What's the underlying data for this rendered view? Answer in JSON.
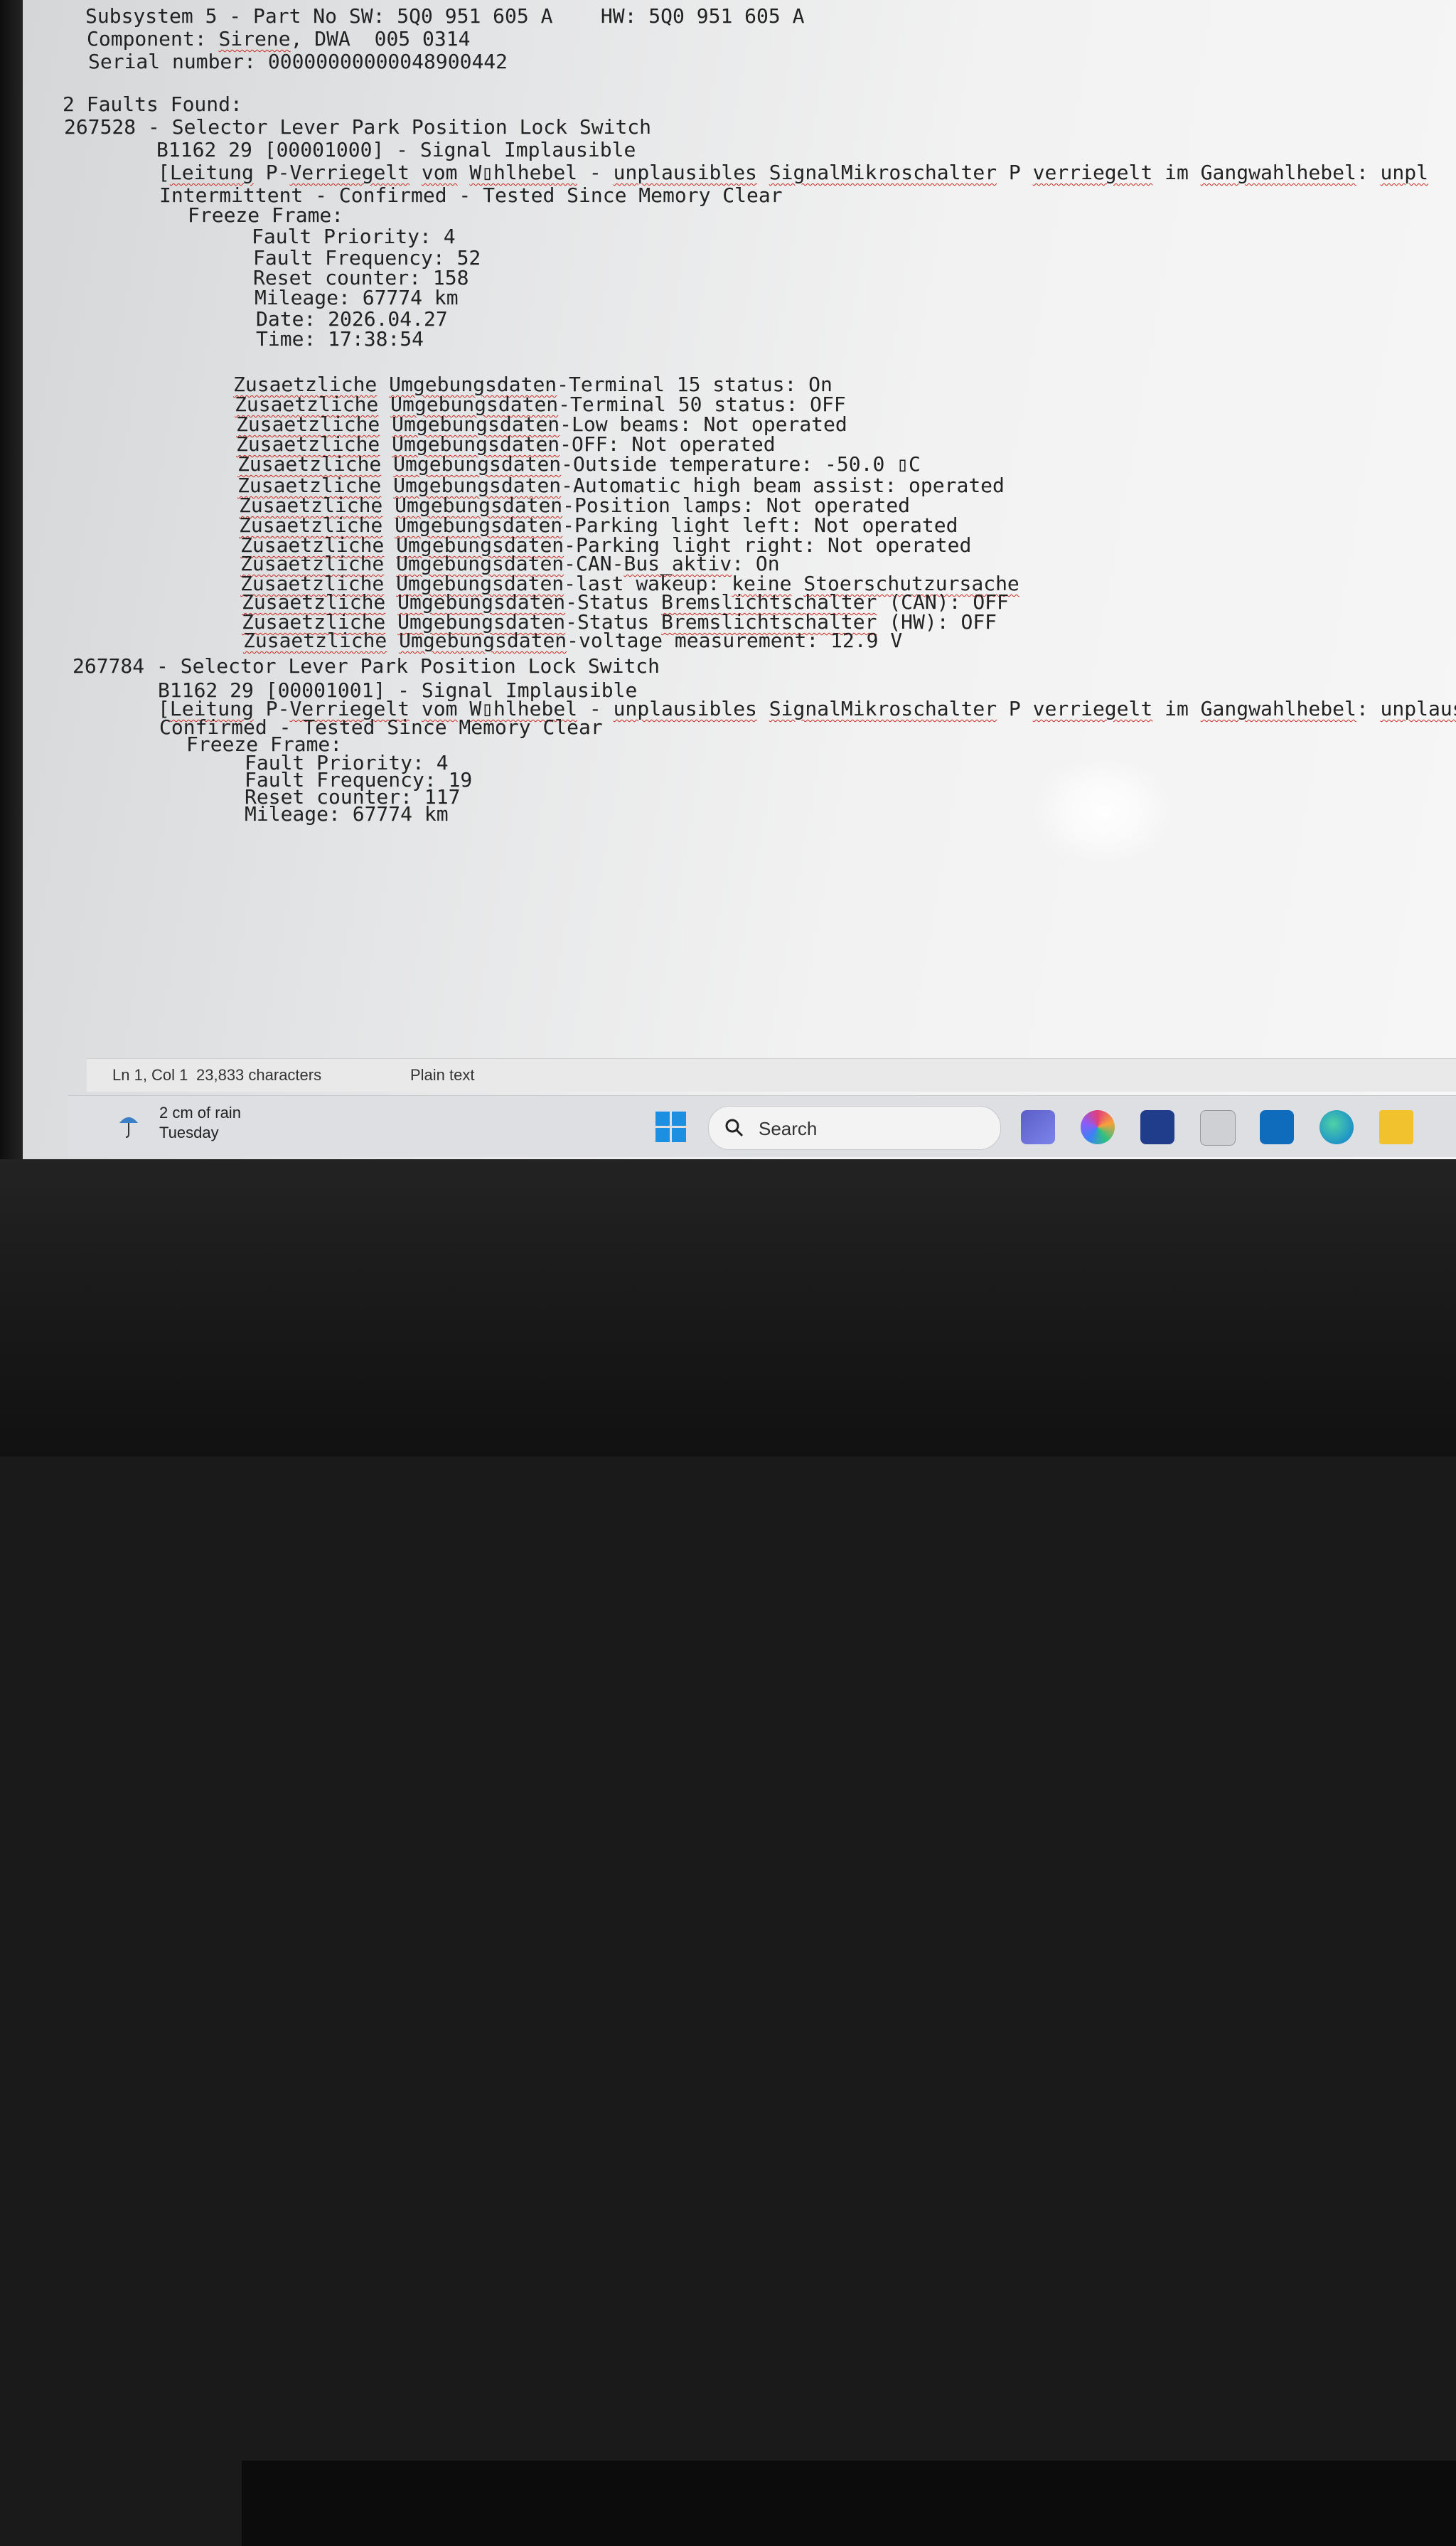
{
  "editor": {
    "lines": [
      {
        "parts": [
          {
            "t": "Subsystem 5 - Part No SW: 5Q0 951 605 A    HW: 5Q0 951 605 A"
          }
        ]
      },
      {
        "parts": [
          {
            "t": "Component: "
          },
          {
            "t": "Sirene",
            "sq": true
          },
          {
            "t": ", DWA  005 0314"
          }
        ]
      },
      {
        "parts": [
          {
            "t": "Serial number: 00000000000048900442"
          }
        ]
      },
      {
        "parts": [
          {
            "t": "2 Faults Found:"
          }
        ]
      },
      {
        "parts": [
          {
            "t": "267528 - Selector Lever Park Position Lock Switch"
          }
        ]
      },
      {
        "parts": [
          {
            "t": "B1162 29 [00001000] - Signal Implausible"
          }
        ]
      },
      {
        "parts": [
          {
            "t": "["
          },
          {
            "t": "Leitung",
            "sq": true
          },
          {
            "t": " P-"
          },
          {
            "t": "Verriegelt",
            "sq": true
          },
          {
            "t": " "
          },
          {
            "t": "vom",
            "sq": true
          },
          {
            "t": " "
          },
          {
            "t": "W▯hlhebel",
            "sq": true
          },
          {
            "t": " - "
          },
          {
            "t": "unplausibles",
            "sq": true
          },
          {
            "t": " "
          },
          {
            "t": "SignalMikroschalter",
            "sq": true
          },
          {
            "t": " P "
          },
          {
            "t": "verriegelt",
            "sq": true
          },
          {
            "t": " im "
          },
          {
            "t": "Gangwahlhebel",
            "sq": true
          },
          {
            "t": ": "
          },
          {
            "t": "unpl",
            "sq": true
          }
        ]
      },
      {
        "parts": [
          {
            "t": "Intermittent - Confirmed - Tested Since Memory Clear"
          }
        ]
      },
      {
        "parts": [
          {
            "t": "Freeze Frame:"
          }
        ]
      },
      {
        "parts": [
          {
            "t": "Fault Priority: 4"
          }
        ]
      },
      {
        "parts": [
          {
            "t": "Fault Frequency: 52"
          }
        ]
      },
      {
        "parts": [
          {
            "t": "Reset counter: 158"
          }
        ]
      },
      {
        "parts": [
          {
            "t": "Mileage: 67774 km"
          }
        ]
      },
      {
        "parts": [
          {
            "t": "Date: 2026.04.27"
          }
        ]
      },
      {
        "parts": [
          {
            "t": "Time: 17:38:54"
          }
        ]
      },
      {
        "parts": [
          {
            "t": "Zusaetzliche",
            "sq": true
          },
          {
            "t": " "
          },
          {
            "t": "Umgebungsdaten",
            "sq": true
          },
          {
            "t": "-Terminal 15 status: On"
          }
        ]
      },
      {
        "parts": [
          {
            "t": "Zusaetzliche",
            "sq": true
          },
          {
            "t": " "
          },
          {
            "t": "Umgebungsdaten",
            "sq": true
          },
          {
            "t": "-Terminal 50 status: OFF"
          }
        ]
      },
      {
        "parts": [
          {
            "t": "Zusaetzliche",
            "sq": true
          },
          {
            "t": " "
          },
          {
            "t": "Umgebungsdaten",
            "sq": true
          },
          {
            "t": "-Low beams: Not operated"
          }
        ]
      },
      {
        "parts": [
          {
            "t": "Zusaetzliche",
            "sq": true
          },
          {
            "t": " "
          },
          {
            "t": "Umgebungsdaten",
            "sq": true
          },
          {
            "t": "-OFF: Not operated"
          }
        ]
      },
      {
        "parts": [
          {
            "t": "Zusaetzliche",
            "sq": true
          },
          {
            "t": " "
          },
          {
            "t": "Umgebungsdaten",
            "sq": true
          },
          {
            "t": "-Outside temperature: -50.0 ▯C"
          }
        ]
      },
      {
        "parts": [
          {
            "t": "Zusaetzliche",
            "sq": true
          },
          {
            "t": " "
          },
          {
            "t": "Umgebungsdaten",
            "sq": true
          },
          {
            "t": "-Automatic high beam assist: operated"
          }
        ]
      },
      {
        "parts": [
          {
            "t": "Zusaetzliche",
            "sq": true
          },
          {
            "t": " "
          },
          {
            "t": "Umgebungsdaten",
            "sq": true
          },
          {
            "t": "-Position lamps: Not operated"
          }
        ]
      },
      {
        "parts": [
          {
            "t": "Zusaetzliche",
            "sq": true
          },
          {
            "t": " "
          },
          {
            "t": "Umgebungsdaten",
            "sq": true
          },
          {
            "t": "-Parking light left: Not operated"
          }
        ]
      },
      {
        "parts": [
          {
            "t": "Zusaetzliche",
            "sq": true
          },
          {
            "t": " "
          },
          {
            "t": "Umgebungsdaten",
            "sq": true
          },
          {
            "t": "-Parking light right: Not operated"
          }
        ]
      },
      {
        "parts": [
          {
            "t": "Zusaetzliche",
            "sq": true
          },
          {
            "t": " "
          },
          {
            "t": "Umgebungsdaten",
            "sq": true
          },
          {
            "t": "-CAN-"
          },
          {
            "t": "Bus_aktiv",
            "sq": true
          },
          {
            "t": ": On"
          }
        ]
      },
      {
        "parts": [
          {
            "t": "Zusaetzliche",
            "sq": true
          },
          {
            "t": " "
          },
          {
            "t": "Umgebungsdaten",
            "sq": true
          },
          {
            "t": "-last wakeup: "
          },
          {
            "t": "keine",
            "sq": true
          },
          {
            "t": " "
          },
          {
            "t": "Stoerschutzursache",
            "sq": true
          }
        ]
      },
      {
        "parts": [
          {
            "t": "Zusaetzliche",
            "sq": true
          },
          {
            "t": " "
          },
          {
            "t": "Umgebungsdaten",
            "sq": true
          },
          {
            "t": "-Status "
          },
          {
            "t": "Bremslichtschalter",
            "sq": true
          },
          {
            "t": " (CAN): OFF"
          }
        ]
      },
      {
        "parts": [
          {
            "t": "Zusaetzliche",
            "sq": true
          },
          {
            "t": " "
          },
          {
            "t": "Umgebungsdaten",
            "sq": true
          },
          {
            "t": "-Status "
          },
          {
            "t": "Bremslichtschalter",
            "sq": true
          },
          {
            "t": " (HW): OFF"
          }
        ]
      },
      {
        "parts": [
          {
            "t": "Zusaetzliche",
            "sq": true
          },
          {
            "t": " "
          },
          {
            "t": "Umgebungsdaten",
            "sq": true
          },
          {
            "t": "-voltage measurement: 12.9 V"
          }
        ]
      },
      {
        "parts": [
          {
            "t": "267784 - Selector Lever Park Position Lock Switch"
          }
        ]
      },
      {
        "parts": [
          {
            "t": "B1162 29 [00001001] - Signal Implausible"
          }
        ]
      },
      {
        "parts": [
          {
            "t": "["
          },
          {
            "t": "Leitung",
            "sq": true
          },
          {
            "t": " P-"
          },
          {
            "t": "Verriegelt",
            "sq": true
          },
          {
            "t": " "
          },
          {
            "t": "vom",
            "sq": true
          },
          {
            "t": " "
          },
          {
            "t": "W▯hlhebel",
            "sq": true
          },
          {
            "t": " - "
          },
          {
            "t": "unplausibles",
            "sq": true
          },
          {
            "t": " "
          },
          {
            "t": "SignalMikroschalter",
            "sq": true
          },
          {
            "t": " P "
          },
          {
            "t": "verriegelt",
            "sq": true
          },
          {
            "t": " im "
          },
          {
            "t": "Gangwahlhebel",
            "sq": true
          },
          {
            "t": ": "
          },
          {
            "t": "unplausibl",
            "sq": true
          }
        ]
      },
      {
        "parts": [
          {
            "t": "Confirmed - Tested Since Memory Clear"
          }
        ]
      },
      {
        "parts": [
          {
            "t": "Freeze Frame:"
          }
        ]
      },
      {
        "parts": [
          {
            "t": "Fault Priority: 4"
          }
        ]
      },
      {
        "parts": [
          {
            "t": "Fault Frequency: 19"
          }
        ]
      },
      {
        "parts": [
          {
            "t": "Reset counter: 117"
          }
        ]
      },
      {
        "parts": [
          {
            "t": "Mileage: 67774 km"
          }
        ]
      }
    ]
  },
  "statusbar": {
    "position": "Ln 1, Col 1",
    "characters": "23,833 characters",
    "format": "Plain text"
  },
  "taskbar": {
    "weather_line1": "2 cm of rain",
    "weather_line2": "Tuesday",
    "search_label": "Search",
    "icons": [
      "teams-icon",
      "copilot-icon",
      "store-icon",
      "vcds-icon",
      "outlook-icon",
      "edge-icon",
      "file-explorer-icon"
    ]
  },
  "colors": {
    "spellcheck_underline": "#c8281e",
    "windows_blue": "#1d8fe0"
  }
}
